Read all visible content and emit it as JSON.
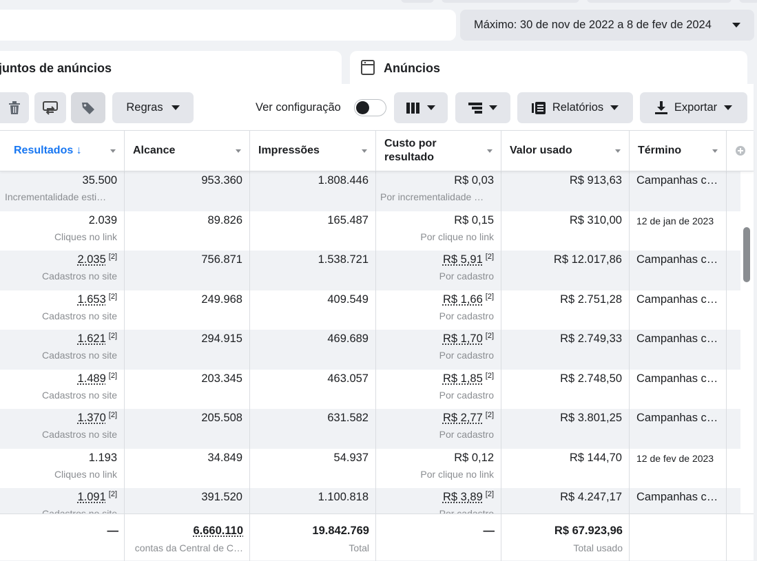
{
  "date_range": {
    "label": "Máximo: 30 de nov de 2022 a 8 de fev de 2024"
  },
  "tabs": {
    "adsets": "juntos de anúncios",
    "ads": "Anúncios"
  },
  "toolbar": {
    "rules": "Regras",
    "view_config": "Ver configuração",
    "reports": "Relatórios",
    "export": "Exportar"
  },
  "table": {
    "headers": {
      "results": "Resultados ↓",
      "reach": "Alcance",
      "impressions": "Impressões",
      "cost_per_result_1": "Custo por",
      "cost_per_result_2": "resultado",
      "amount_spent": "Valor usado",
      "end": "Término"
    },
    "rows": [
      {
        "results": "35.500",
        "results_sub": "Incrementalidade esti…",
        "reach": "953.360",
        "impressions": "1.808.446",
        "cost": "R$ 0,03",
        "cost_sub": "Por incrementalidade …",
        "spent": "R$ 913,63",
        "end": "Campanhas c…"
      },
      {
        "results": "2.039",
        "results_sub": "Cliques no link",
        "reach": "89.826",
        "impressions": "165.487",
        "cost": "R$ 0,15",
        "cost_sub": "Por clique no link",
        "spent": "R$ 310,00",
        "end": "12 de jan de 2023"
      },
      {
        "results": "2.035",
        "note": "[2]",
        "results_sub": "Cadastros no site",
        "reach": "756.871",
        "impressions": "1.538.721",
        "cost": "R$ 5,91",
        "cost_note": "[2]",
        "cost_sub": "Por cadastro",
        "spent": "R$ 12.017,86",
        "end": "Campanhas c…"
      },
      {
        "results": "1.653",
        "note": "[2]",
        "results_sub": "Cadastros no site",
        "reach": "249.968",
        "impressions": "409.549",
        "cost": "R$ 1,66",
        "cost_note": "[2]",
        "cost_sub": "Por cadastro",
        "spent": "R$ 2.751,28",
        "end": "Campanhas c…"
      },
      {
        "results": "1.621",
        "note": "[2]",
        "results_sub": "Cadastros no site",
        "reach": "294.915",
        "impressions": "469.689",
        "cost": "R$ 1,70",
        "cost_note": "[2]",
        "cost_sub": "Por cadastro",
        "spent": "R$ 2.749,33",
        "end": "Campanhas c…"
      },
      {
        "results": "1.489",
        "note": "[2]",
        "results_sub": "Cadastros no site",
        "reach": "203.345",
        "impressions": "463.057",
        "cost": "R$ 1,85",
        "cost_note": "[2]",
        "cost_sub": "Por cadastro",
        "spent": "R$ 2.748,50",
        "end": "Campanhas c…"
      },
      {
        "results": "1.370",
        "note": "[2]",
        "results_sub": "Cadastros no site",
        "reach": "205.508",
        "impressions": "631.582",
        "cost": "R$ 2,77",
        "cost_note": "[2]",
        "cost_sub": "Por cadastro",
        "spent": "R$ 3.801,25",
        "end": "Campanhas c…"
      },
      {
        "results": "1.193",
        "results_sub": "Cliques no link",
        "reach": "34.849",
        "impressions": "54.937",
        "cost": "R$ 0,12",
        "cost_sub": "Por clique no link",
        "spent": "R$ 144,70",
        "end": "12 de fev de 2023"
      },
      {
        "results": "1.091",
        "note": "[2]",
        "results_sub": "Cadastros no site",
        "reach": "391.520",
        "impressions": "1.100.818",
        "cost": "R$ 3,89",
        "cost_note": "[2]",
        "cost_sub": "Por cadastro",
        "spent": "R$ 4.247,17",
        "end": "Campanhas c…"
      }
    ],
    "totals": {
      "results": "—",
      "reach": "6.660.110",
      "reach_sub": "contas da Central de C…",
      "impressions": "19.842.769",
      "impressions_sub": "Total",
      "cost": "—",
      "spent": "R$ 67.923,96",
      "spent_sub": "Total usado"
    }
  },
  "colors": {
    "accent": "#1877f2",
    "row_alt": "#f0f2f5",
    "button": "#e4e6eb"
  }
}
